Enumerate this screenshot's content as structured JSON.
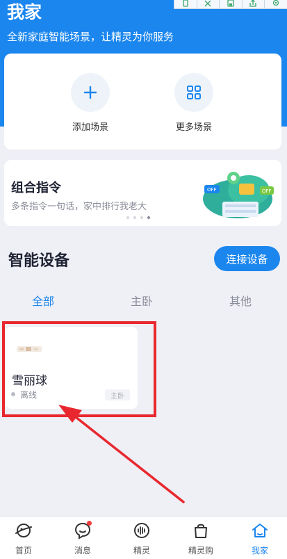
{
  "header": {
    "title": "我家",
    "subtitle": "全新家庭智能场景，让精灵为你服务",
    "accent_color": "#1b86ee"
  },
  "window_controls": {
    "icons": [
      "tablet-icon",
      "scissors-icon",
      "save-icon",
      "share-icon",
      "settings-icon"
    ]
  },
  "scenes": {
    "add_label": "添加场景",
    "more_label": "更多场景"
  },
  "combo": {
    "title": "组合指令",
    "subtitle": "多条指令一句话，家中排行我老大",
    "page_count": 4,
    "active_page": 4,
    "illustration_text": [
      "OFF",
      "OFF"
    ]
  },
  "devices": {
    "section_title": "智能设备",
    "connect_label": "连接设备",
    "tabs": [
      {
        "label": "全部",
        "active": true
      },
      {
        "label": "主卧",
        "active": false
      },
      {
        "label": "其他",
        "active": false
      }
    ],
    "items": [
      {
        "name": "雪丽球",
        "status": "离线",
        "room": "主卧"
      }
    ]
  },
  "annotation": {
    "color": "#e8282e"
  },
  "tabbar": {
    "items": [
      {
        "label": "首页",
        "icon": "planet-icon",
        "active": false
      },
      {
        "label": "消息",
        "icon": "chat-bubble-icon",
        "active": false,
        "badge": true
      },
      {
        "label": "精灵",
        "icon": "voice-wave-icon",
        "active": false
      },
      {
        "label": "精灵购",
        "icon": "shopping-bag-icon",
        "active": false
      },
      {
        "label": "我家",
        "icon": "home-icon",
        "active": true
      }
    ]
  }
}
